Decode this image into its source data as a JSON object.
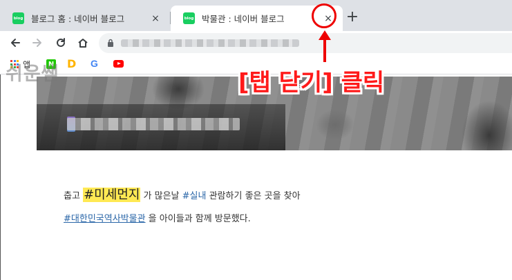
{
  "tabs": [
    {
      "favicon_text": "blog",
      "title": "블로그 홈 : 네이버 블로그",
      "close": "×",
      "active": false
    },
    {
      "favicon_text": "blog",
      "title": "박물관 : 네이버 블로그",
      "close": "×",
      "active": true
    }
  ],
  "new_tab": "+",
  "toolbar": {
    "url_placeholder": ""
  },
  "bookmarks": {
    "apps_label": "앱",
    "naver": "N",
    "daum": "D",
    "google": "G",
    "youtube": "youtube-icon"
  },
  "watermark": "쉬운쌤",
  "post": {
    "line1_prefix": "춥고 ",
    "line1_highlight": "#미세먼지",
    "line1_mid": " 가 많은날 ",
    "line1_tag": "#실내",
    "line1_suffix": " 관람하기 좋은 곳을 찾아",
    "line2_tag": "#대한민국역사박물관",
    "line2_suffix": " 을 아이들과 함께 방문했다."
  },
  "annotation": {
    "label": "[탭 닫기] 클릭",
    "color": "#ee0000"
  }
}
